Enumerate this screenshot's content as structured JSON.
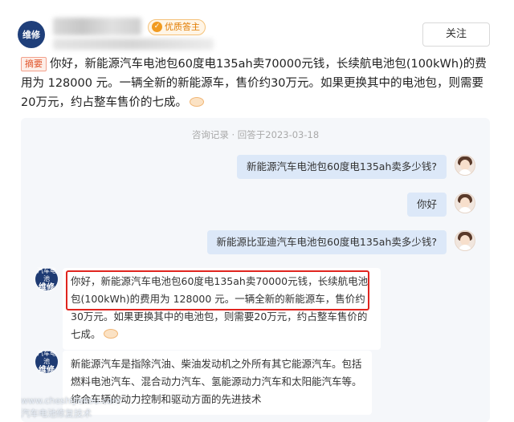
{
  "header": {
    "avatar_text": "维修",
    "badge": "优质答主",
    "follow_label": "关注"
  },
  "summary": {
    "tag": "摘要",
    "text": "你好，新能源汽车电池包60度电135ah卖70000元钱，长续航电池包(100kWh)的费用为 128000 元。一辆全新的新能源车，售价约30万元。如果更换其中的电池包，则需要20万元，约占整车售价的七成。"
  },
  "record_label": "咨询记录 · 回答于2023-03-18",
  "questions": [
    "新能源汽车电池包60度电135ah卖多少钱?",
    "你好",
    "新能源比亚迪汽车电池包60度电135ah卖多少钱?"
  ],
  "bot_avatar": {
    "line1": "汽车电池",
    "line2": "维修"
  },
  "answers": [
    "你好，新能源汽车电池包60度电135ah卖70000元钱，长续航电池包(100kWh)的费用为 128000 元。一辆全新的新能源车，售价约30万元。如果更换其中的电池包，则需要20万元，约占整车售价的七成。",
    "新能源汽车是指除汽油、柴油发动机之外所有其它能源汽车。包括燃料电池汽车、混合动力汽车、氢能源动力汽车和太阳能汽车等。综合车辆的动力控制和驱动方面的先进技术"
  ],
  "watermark": [
    "www.cheshijiekou.com",
    "汽车电池修复技术"
  ],
  "colors": {
    "highlight": "#e0251f",
    "question_bubble": "#dce8f8",
    "badge": "#e07b00"
  }
}
